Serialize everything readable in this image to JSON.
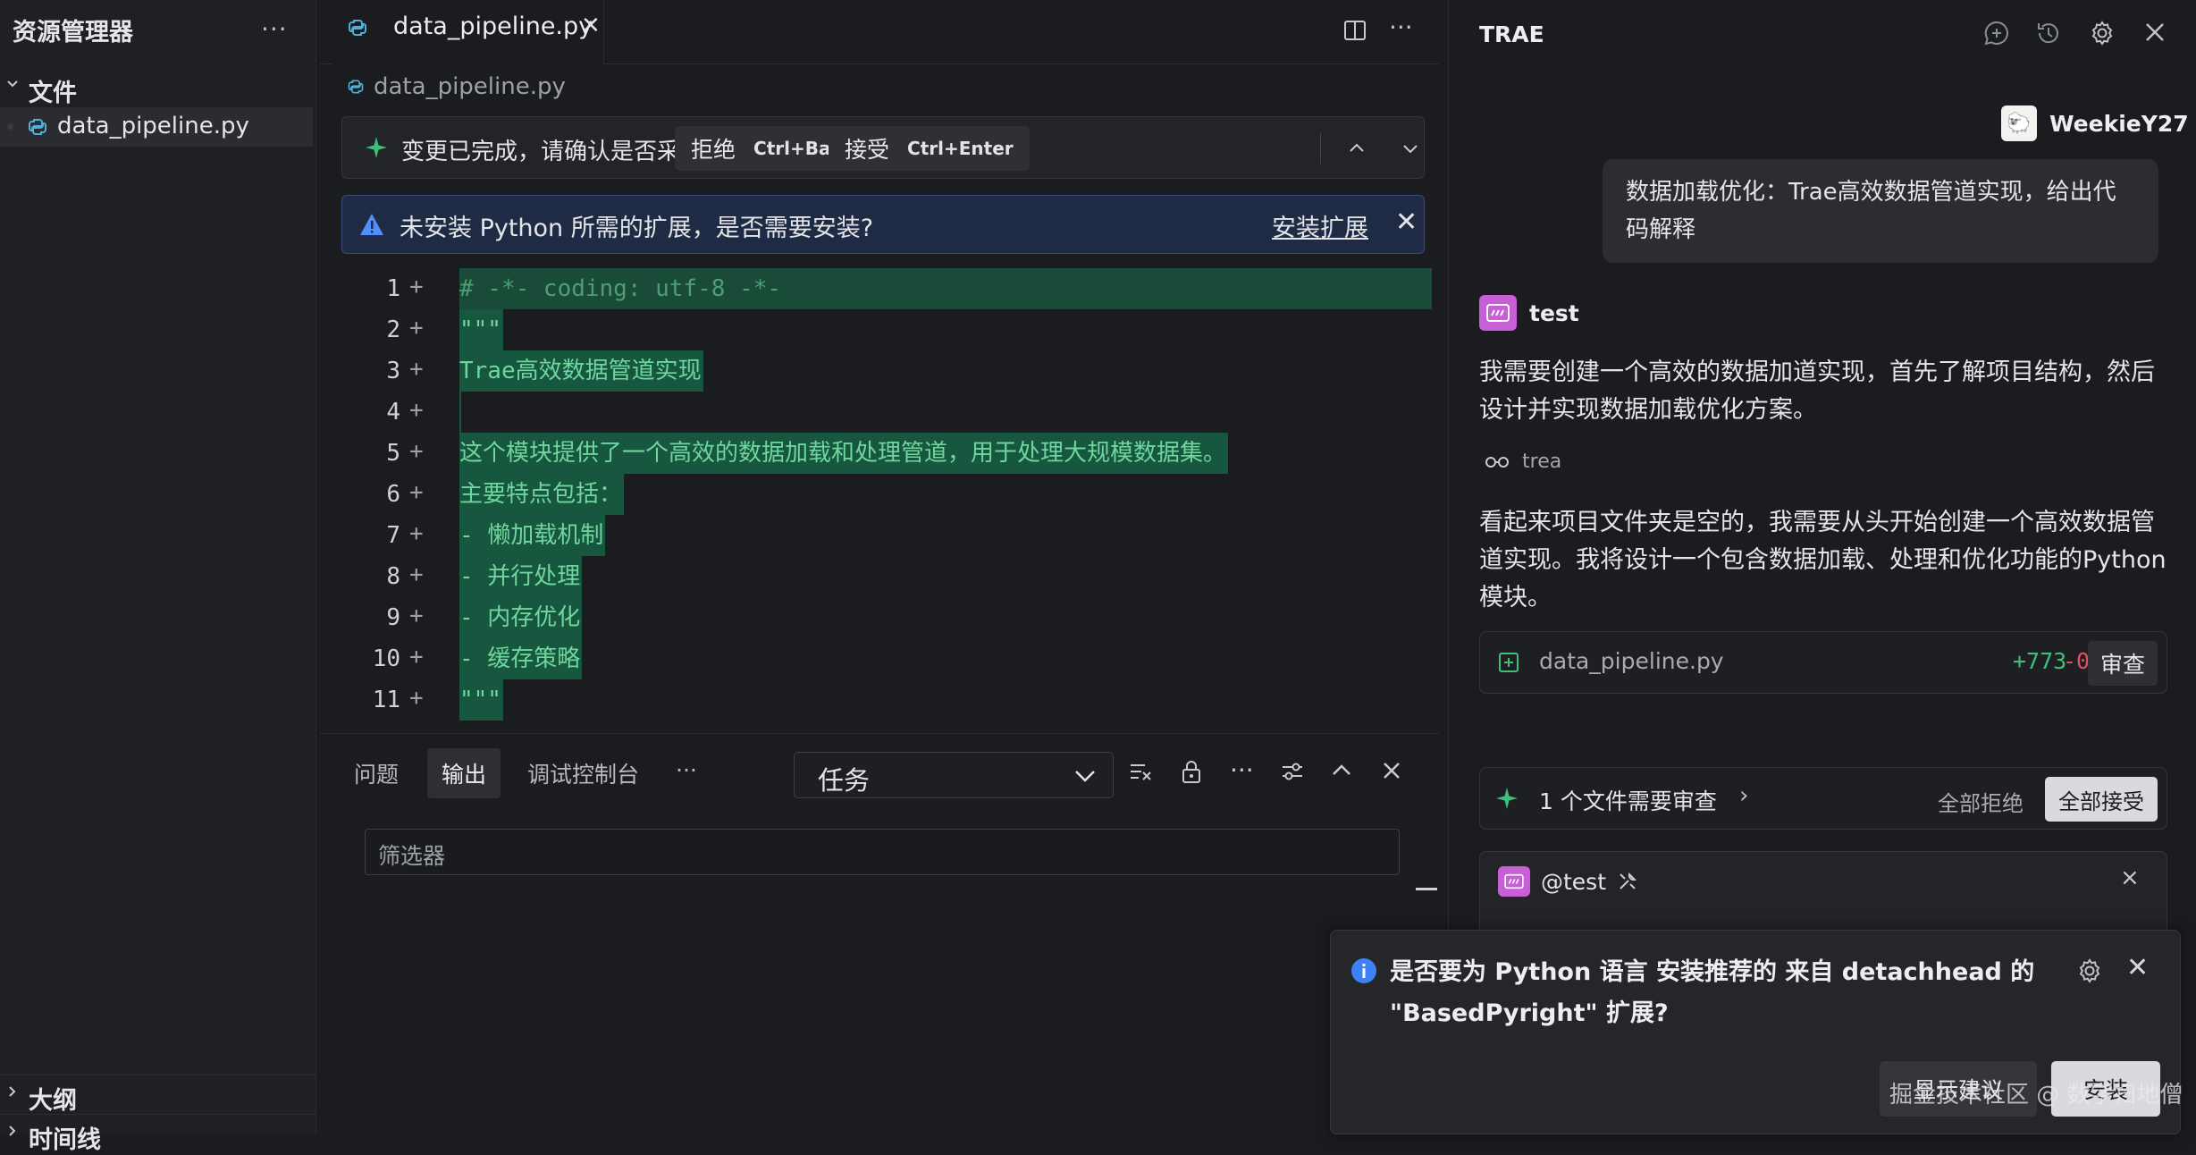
{
  "explorer": {
    "title": "资源管理器",
    "more": "···",
    "files_section": "文件",
    "file_name": "data_pipeline.py",
    "outline_section": "大纲",
    "timeline_section": "时间线"
  },
  "editor": {
    "tab_name": "data_pipeline.py",
    "tab_close": "✕",
    "more": "···",
    "breadcrumb": "data_pipeline.py",
    "diff_bar": {
      "message": "变更已完成，请确认是否采纳。",
      "reject_label": "拒绝",
      "reject_shortcut": "Ctrl+Backspace",
      "accept_label": "接受",
      "accept_shortcut": "Ctrl+Enter"
    },
    "notice": {
      "message": "未安装 Python 所需的扩展，是否需要安装?",
      "link": "安装扩展",
      "close": "✕"
    },
    "code_lines": [
      {
        "num": "1",
        "text": "# -*- coding: utf-8 -*-"
      },
      {
        "num": "2",
        "text": "\"\"\""
      },
      {
        "num": "3",
        "text": "Trae高效数据管道实现"
      },
      {
        "num": "4",
        "text": ""
      },
      {
        "num": "5",
        "text": "这个模块提供了一个高效的数据加载和处理管道，用于处理大规模数据集。"
      },
      {
        "num": "6",
        "text": "主要特点包括："
      },
      {
        "num": "7",
        "text": "- 懒加载机制"
      },
      {
        "num": "8",
        "text": "- 并行处理"
      },
      {
        "num": "9",
        "text": "- 内存优化"
      },
      {
        "num": "10",
        "text": "- 缓存策略"
      },
      {
        "num": "11",
        "text": "\"\"\""
      }
    ]
  },
  "panel": {
    "tabs": [
      "问题",
      "输出",
      "调试控制台"
    ],
    "more": "···",
    "task_select": "任务",
    "filter_placeholder": "筛选器"
  },
  "trae": {
    "title": "TRAE",
    "username": "WeekieY27",
    "user_message": "数据加载优化：Trae高效数据管道实现，给出代码解释",
    "bot_name": "test",
    "reply_1": "我需要创建一个高效的数据加道实现，首先了解项目结构，然后设计并实现数据加载优化方案。",
    "thinking_label": "trea",
    "reply_2": "看起来项目文件夹是空的，我需要从头开始创建一个高效数据管道实现。我将设计一个包含数据加载、处理和优化功能的Python模块。",
    "file_card": {
      "name": "data_pipeline.py",
      "added": "+773",
      "removed": "-0",
      "review": "审查"
    },
    "review_bar": {
      "text": "1 个文件需要审查",
      "chevron": "›",
      "reject_all": "全部拒绝",
      "accept_all": "全部接受"
    },
    "input_mention": "@test",
    "input_close": "×"
  },
  "toast": {
    "message": "是否要为 Python 语言 安装推荐的 来自 detachhead 的 \"BasedPyright\" 扩展?",
    "show_recommendations": "显示建议",
    "install": "安装",
    "close": "✕"
  },
  "watermark": "掘金技术社区 @ 数字扫地僧",
  "colors": {
    "accent_green": "#3ec07b",
    "diff_removed": "#e05260",
    "code_added_bg": "#17563f",
    "notice_bg": "#1f2b45",
    "bot_icon": "#c95fd6"
  }
}
